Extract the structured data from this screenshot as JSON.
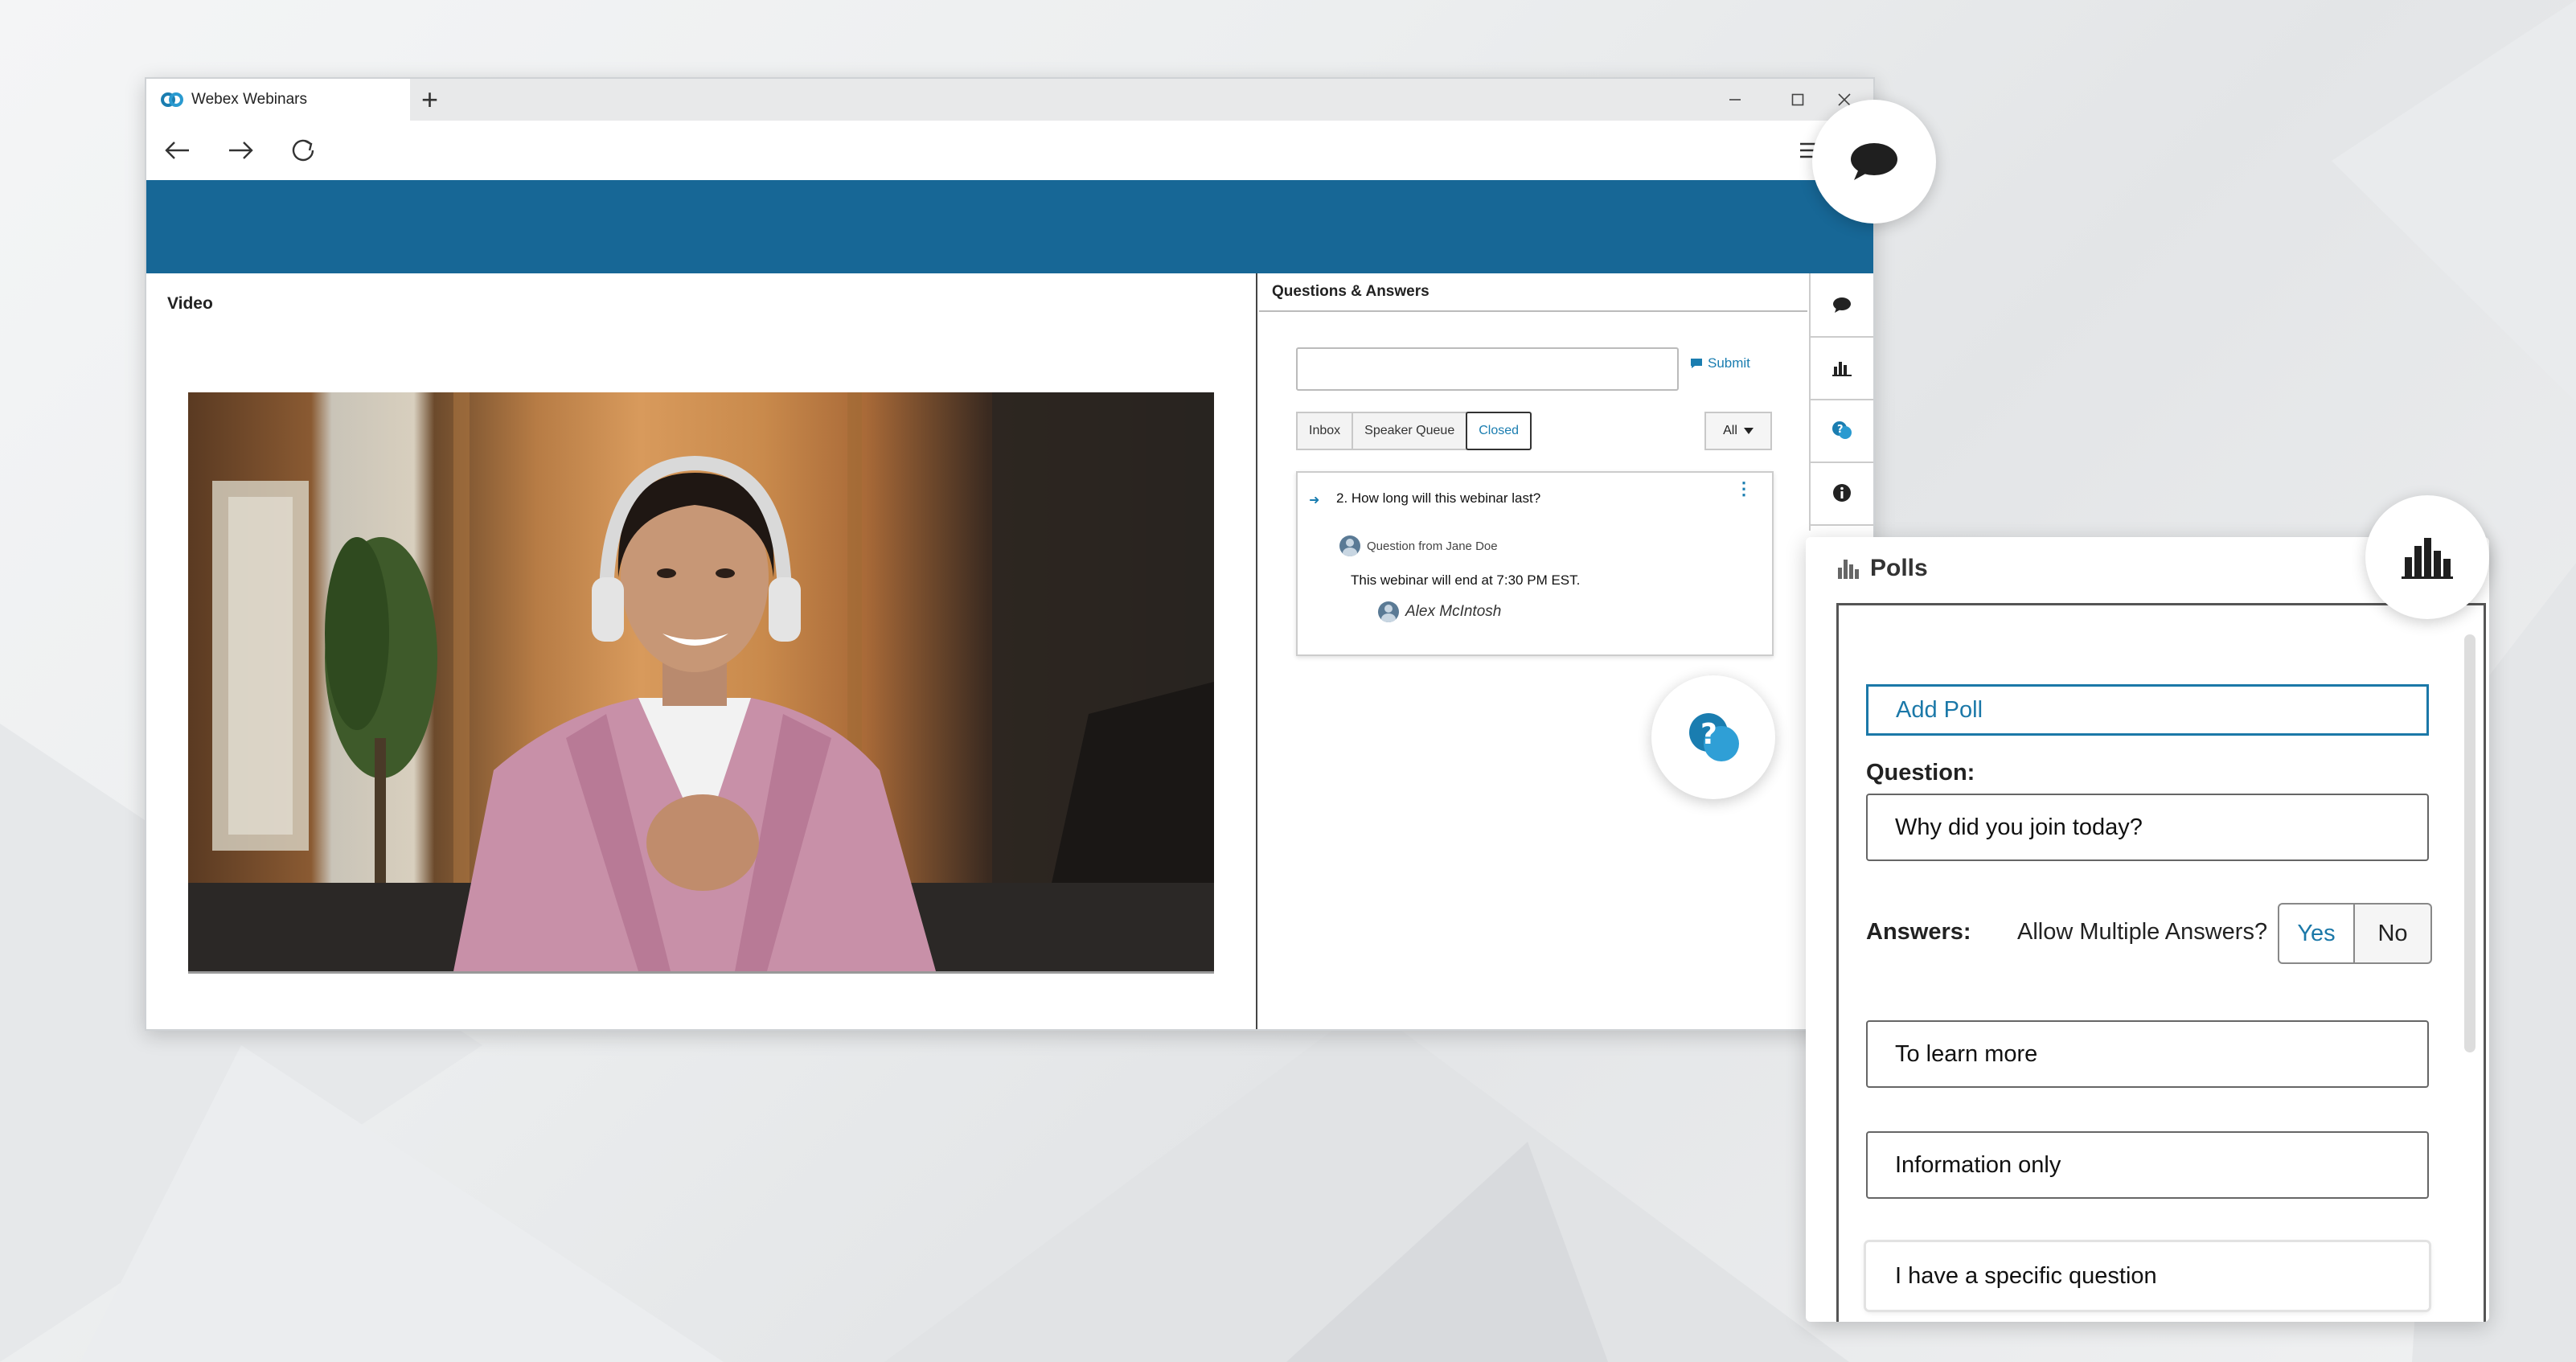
{
  "browser": {
    "tab_title": "Webex Webinars",
    "new_tab_icon": "plus-icon",
    "window_controls": [
      "minimize-icon",
      "maximize-icon",
      "close-icon"
    ],
    "nav_icons": [
      "back-arrow-icon",
      "forward-arrow-icon",
      "reload-icon"
    ],
    "toolbar_icons": [
      "reading-list-icon",
      "edit-note-icon"
    ]
  },
  "colors": {
    "banner": "#176796",
    "accent": "#1b78a8"
  },
  "video": {
    "heading": "Video"
  },
  "qa": {
    "heading": "Questions & Answers",
    "submit_label": "Submit",
    "tabs": [
      "Inbox",
      "Speaker Queue",
      "Closed"
    ],
    "active_tab": "Closed",
    "filter": "All",
    "question": {
      "text": "2. How long will this  webinar last?",
      "asker": "Question from Jane Doe",
      "answer": "This webinar will end at 7:30 PM EST.",
      "answerer": "Alex McIntosh"
    }
  },
  "side_rail": [
    "chat-icon",
    "polls-icon",
    "qa-icon",
    "info-icon"
  ],
  "polls": {
    "title": "Polls",
    "add_poll_label": "Add Poll",
    "question_label": "Question:",
    "question_value": "Why did you join today?",
    "answers_label": "Answers:",
    "allow_multiple_label": "Allow Multiple Answers?",
    "yes_label": "Yes",
    "no_label": "No",
    "answers": [
      "To learn more",
      "Information only",
      "I have a specific question"
    ]
  }
}
